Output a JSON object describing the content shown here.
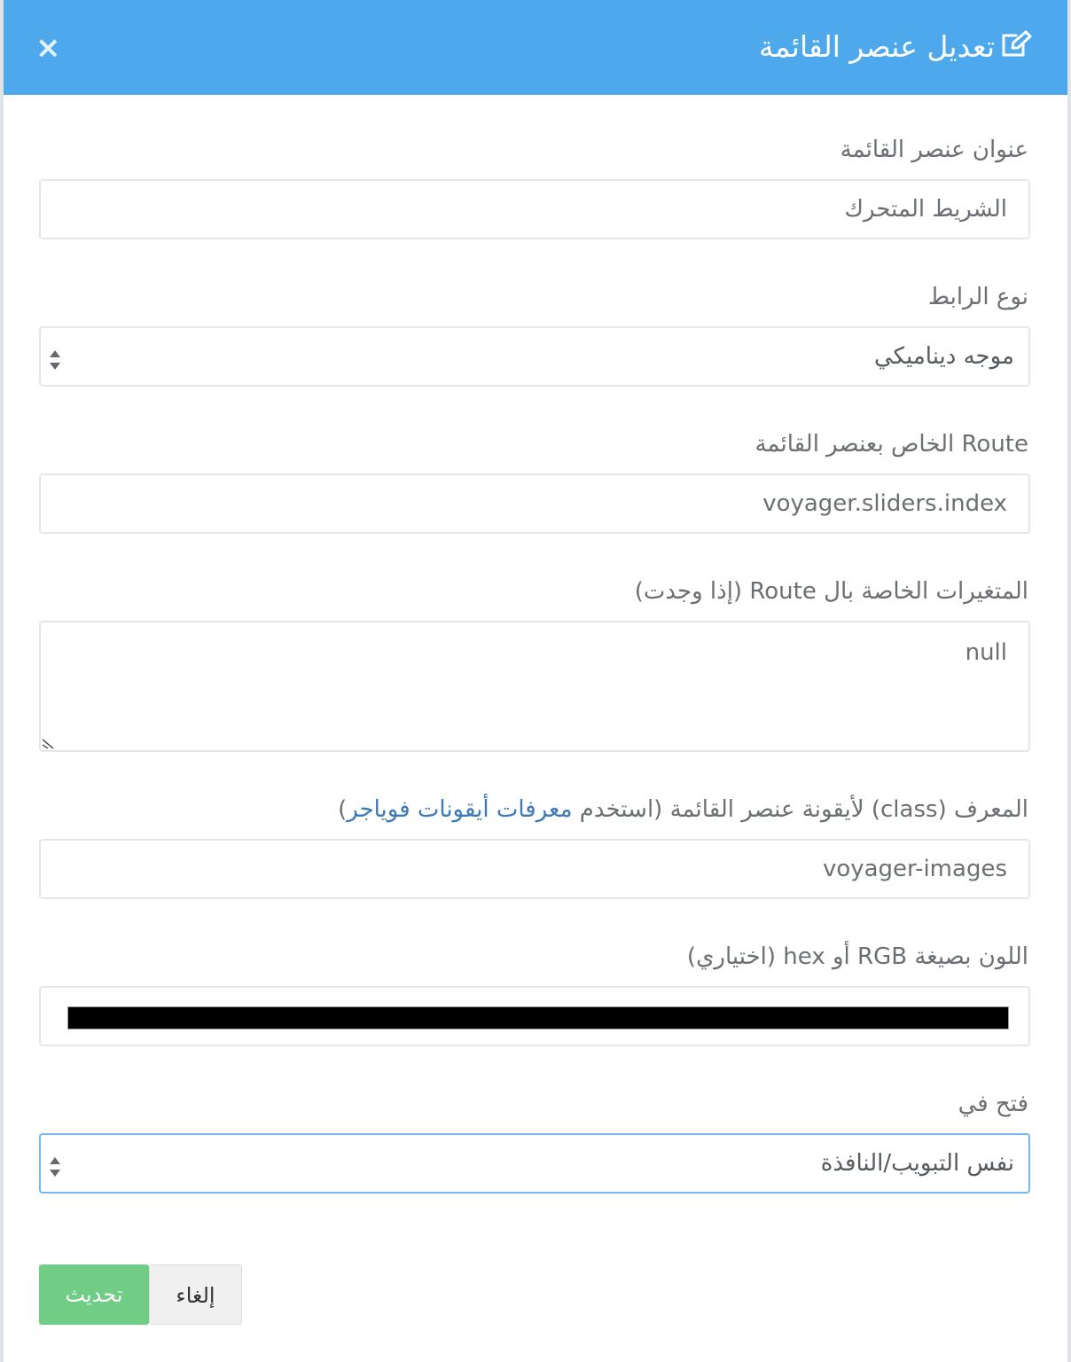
{
  "header": {
    "title": "تعديل عنصر القائمة",
    "close_label": "×",
    "background_color": "#4ea8ec"
  },
  "form": {
    "title_label": "عنوان عنصر القائمة",
    "title_value": "الشريط المتحرك",
    "link_type_label": "نوع الرابط",
    "link_type_value": "موجه ديناميكي",
    "route_label": "Route الخاص بعنصر القائمة",
    "route_value": "voyager.sliders.index",
    "params_label": "المتغيرات الخاصة بال Route (إذا وجدت)",
    "params_value": "null",
    "icon_label_prefix": "المعرف (class) لأيقونة عنصر القائمة (استخدم ",
    "icon_label_link": "معرفات أيقونات فوياجر",
    "icon_label_suffix": ")",
    "icon_value": "voyager-images",
    "color_label": "اللون بصيغة RGB أو hex (اختياري)",
    "color_value": "#000000",
    "target_label": "فتح في",
    "target_value": "نفس التبويب/النافذة"
  },
  "buttons": {
    "update_label": "تحديث",
    "cancel_label": "إلغاء",
    "update_color": "#6fcd85"
  },
  "icons": {
    "edit": "edit-icon",
    "close": "close-icon",
    "select_arrows": "select-arrows-icon"
  }
}
